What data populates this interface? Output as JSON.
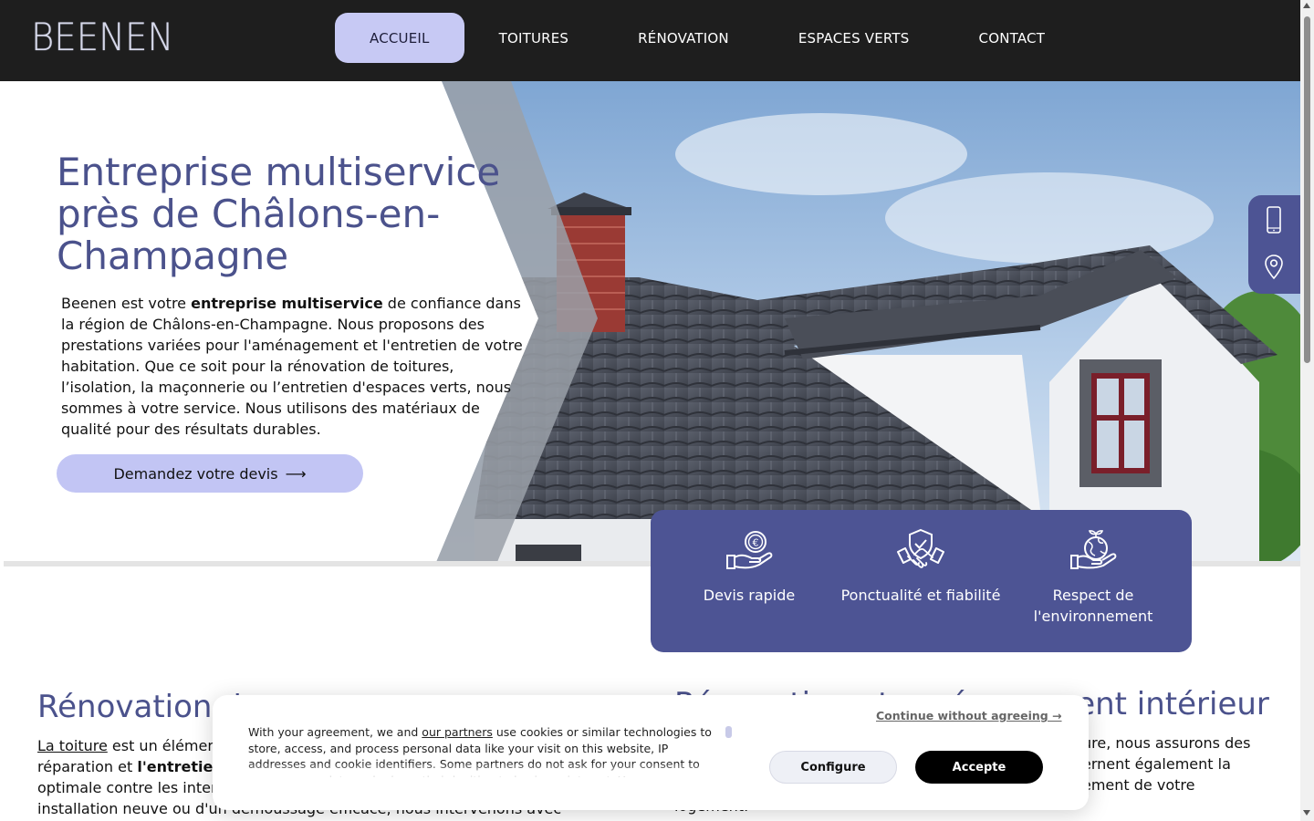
{
  "brand": {
    "logo_text": "BEENEN"
  },
  "nav": {
    "items": [
      {
        "label": "ACCUEIL",
        "active": true
      },
      {
        "label": "TOITURES",
        "active": false
      },
      {
        "label": "RÉNOVATION",
        "active": false
      },
      {
        "label": "ESPACES VERTS",
        "active": false
      },
      {
        "label": "CONTACT",
        "active": false
      }
    ]
  },
  "hero": {
    "title": "Entreprise multiservice près de Châlons-en-Champagne",
    "text_before": "Beenen est votre ",
    "text_bold": "entreprise multiservice",
    "text_after": " de confiance dans la région de Châlons-en-Champagne. Nous proposons des prestations variées pour l'aménagement et l'entretien de votre habitation. Que ce soit pour la rénovation de toitures, l’isolation, la maçonnerie ou l’entretien d'espaces verts, nous sommes à votre service. Nous utilisons des matériaux de qualité pour des résultats durables.",
    "cta_label": "Demandez votre devis",
    "cta_arrow": "⟶"
  },
  "side_float": {
    "icons": [
      "phone-icon",
      "location-pin-icon"
    ]
  },
  "features": [
    {
      "label": "Devis rapide",
      "icon": "euro-hand-icon"
    },
    {
      "label": "Ponctualité et fiabilité",
      "icon": "handshake-shield-icon"
    },
    {
      "label": "Respect de l'environnement",
      "icon": "earth-hand-icon"
    }
  ],
  "section_left": {
    "title": "Rénovation d",
    "link_text": "La toiture",
    "line1_rest": " est un élémen",
    "line2_a": "réparation et ",
    "line2_bold": "l'entretien",
    "line3": "optimale contre les inter",
    "line4": "installation neuve ou d'un démoussage efficace, nous intervenons avec"
  },
  "section_right": {
    "title": "Rénovation et aménagement intérieur",
    "line1": "ure, nous assurons des",
    "line2": "ernent également la",
    "line3": "ement de votre",
    "line4": "logement."
  },
  "cookie": {
    "text_before": "With your agreement, we and ",
    "link_text": "our partners",
    "text_after": " use cookies or similar technologies to store, access, and process personal data like your visit on this website, IP addresses and cookie identifiers. Some partners do not ask for your consent to process your data and rely on their legitimate business interest. You can",
    "continue_label": "Continue without agreeing →",
    "configure_label": "Configure",
    "accept_label": "Accepte"
  },
  "colors": {
    "header_bg": "#1e1e1e",
    "accent_purple": "#4d5494",
    "nav_active_bg": "#c7c9f4",
    "cta_bg": "#c2c5f4",
    "title_color": "#4b528c"
  }
}
